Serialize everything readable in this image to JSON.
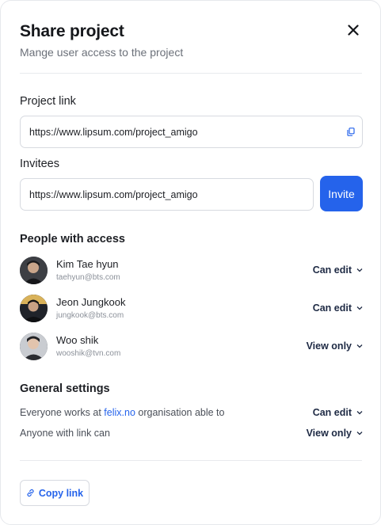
{
  "header": {
    "title": "Share project",
    "subtitle": "Mange user access to the project"
  },
  "project_link": {
    "label": "Project link",
    "value": "https://www.lipsum.com/project_amigo"
  },
  "invitees": {
    "label": "Invitees",
    "value": "https://www.lipsum.com/project_amigo",
    "button_label": "Invite"
  },
  "people": {
    "label": "People with access",
    "items": [
      {
        "name": "Kim Tae hyun",
        "email": "taehyun@bts.com",
        "permission": "Can edit"
      },
      {
        "name": "Jeon Jungkook",
        "email": "jungkook@bts.com",
        "permission": "Can edit"
      },
      {
        "name": "Woo shik",
        "email": "wooshik@tvn.com",
        "permission": "View only"
      }
    ]
  },
  "general": {
    "label": "General settings",
    "row1_prefix": "Everyone works at ",
    "row1_link": "felix.no",
    "row1_suffix": " organisation able to",
    "row1_permission": "Can edit",
    "row2_text": "Anyone with link can",
    "row2_permission": "View only"
  },
  "footer": {
    "copy_link_label": "Copy link"
  },
  "colors": {
    "accent": "#2563eb",
    "permission_text": "#1e2a44"
  },
  "icons": [
    "close-icon",
    "copy-icon",
    "chevron-down-icon",
    "link-icon"
  ]
}
